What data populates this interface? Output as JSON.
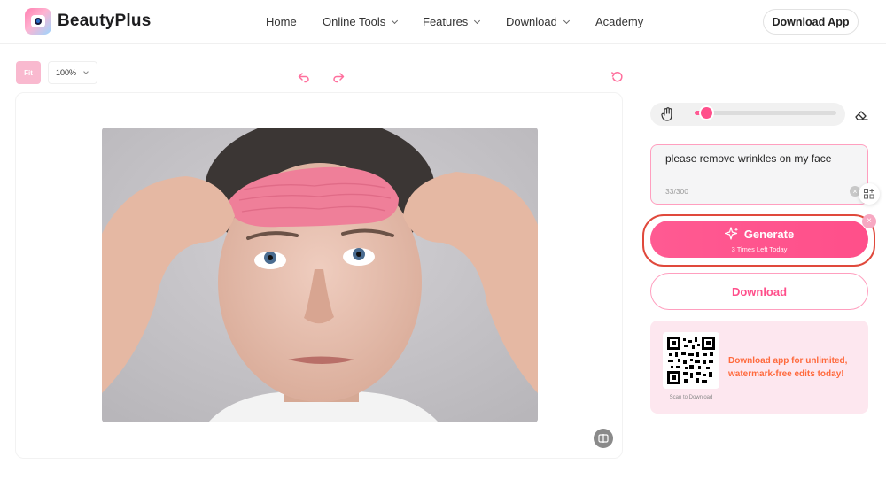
{
  "header": {
    "brand": "BeautyPlus",
    "nav": [
      {
        "label": "Home",
        "has_dropdown": false
      },
      {
        "label": "Online Tools",
        "has_dropdown": true
      },
      {
        "label": "Features",
        "has_dropdown": true
      },
      {
        "label": "Download",
        "has_dropdown": true
      },
      {
        "label": "Academy",
        "has_dropdown": false
      }
    ],
    "download_app": "Download App"
  },
  "toolbar": {
    "fit_label": "Fit",
    "zoom_value": "100%",
    "icons": [
      "undo-icon",
      "redo-icon",
      "reset-icon"
    ]
  },
  "editor": {
    "brush_size_level": 0.08,
    "prompt_text": "please remove wrinkles on my face",
    "char_count": "33/300",
    "generate_label": "Generate",
    "generate_sub": "3 Times Left Today",
    "download_label": "Download"
  },
  "promo": {
    "scan_caption": "Scan to Download",
    "text": "Download app for unlimited, watermark-free edits today!"
  },
  "colors": {
    "accent": "#ff4f8b",
    "accent_light": "#fde7ef",
    "promo_text": "#ff6a3d",
    "highlight_ring": "#e0493c"
  }
}
